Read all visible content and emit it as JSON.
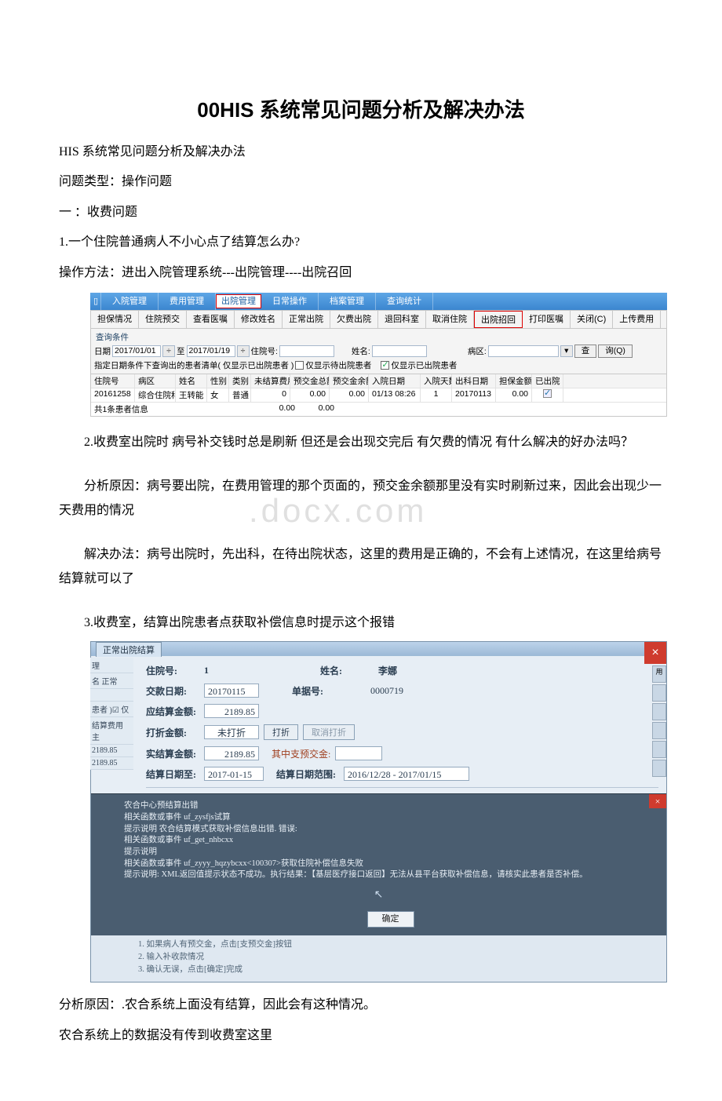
{
  "doc": {
    "title": "00HIS 系统常见问题分析及解决办法",
    "h1": "HIS 系统常见问题分析及解决办法",
    "p_type": "问题类型：操作问题",
    "p_sec1": "一 ：收费问题",
    "q1": "1.一个住院普通病人不小心点了结算怎么办?",
    "a1": "操作方法：进出入院管理系统---出院管理----出院召回",
    "q2": "2.收费室出院时 病号补交钱时总是刷新 但还是会出现交完后 有欠费的情况 有什么解决的好办法吗？",
    "a2a": "分析原因：病号要出院，在费用管理的那个页面的，预交金余额那里没有实时刷新过来，因此会出现少一天费用的情况",
    "a2b": "解决办法：病号出院时，先出科，在待出院状态，这里的费用是正确的，不会有上述情况，在这里给病号结算就可以了",
    "q3": "3.收费室，结算出院患者点获取补偿信息时提示这个报错",
    "a3a": "分析原因：.农合系统上面没有结算，因此会有这种情况。",
    "a3b": " 农合系统上的数据没有传到收费室这里",
    "watermark": ".docx.com"
  },
  "ss1": {
    "tabs": [
      "入院管理",
      "费用管理",
      "出院管理",
      "日常操作",
      "档案管理",
      "查询统计"
    ],
    "toolbar": [
      "担保情况",
      "住院预交",
      "查看医嘱",
      "修改姓名",
      "正常出院",
      "欠费出院",
      "退回科室",
      "取消住院",
      "出院招回",
      "打印医嘱",
      "关闭(C)",
      "上传费用"
    ],
    "filter_title": "查询条件",
    "filter": {
      "lbl_date": "日期",
      "date_from": "2017/01/01",
      "date_to": "2017/01/19",
      "lbl_to": "至",
      "spin": "÷",
      "lbl_zyh": "住院号:",
      "lbl_xm": "姓名:",
      "lbl_bq": "病区:",
      "btn_cha": "查",
      "btn_xun": "询(Q)",
      "note": "指定日期条件下查询出的患者清单( 仅显示已出院患者 )",
      "chk1": "仅显示待出院患者",
      "chk2": "仅显示已出院患者"
    },
    "grid": {
      "head": [
        "住院号",
        "病区",
        "姓名",
        "性别",
        "类别",
        "未结算费用",
        "预交金总额",
        "预交金余额",
        "入院日期",
        "入院天数",
        "出科日期",
        "担保金额",
        "已出院"
      ],
      "row": [
        "20161258",
        "综合住院科",
        "王转能",
        "女",
        "普通",
        "0",
        "0.00",
        "0.00",
        "01/13 08:26",
        "1",
        "20170113",
        "0.00",
        "☑"
      ],
      "foot_label": "共1条患者信息",
      "foot_v1": "0.00",
      "foot_v2": "0.00"
    }
  },
  "ss2": {
    "tab": "正常出院结算",
    "zyh_lbl": "住院号:",
    "zyh": "1",
    "xm_lbl": "姓名:",
    "xm": "李娜",
    "left": [
      "理",
      "名    正常",
      "患者  )☑ 仅",
      "结算费用 主",
      "2189.85",
      "2189.85"
    ],
    "right_btn": "用",
    "jkrq_lbl": "交款日期:",
    "jkrq": "20170115",
    "djh_lbl": "单据号:",
    "djh": "0000719",
    "yjs_lbl": "应结算金额:",
    "yjs": "2189.85",
    "dzje_lbl": "打折金额:",
    "wdz": "未打折",
    "dz_btn": "打折",
    "qxdz": "取消打折",
    "sjs_lbl": "实结算金额:",
    "sjs": "2189.85",
    "qzzf_lbl": "其中支预交金:",
    "jsrq_lbl": "结算日期至:",
    "jsrq": "2017-01-15",
    "jsfw_lbl": "结算日期范围:",
    "jsfw": "2016/12/28 - 2017/01/15",
    "err_lines": [
      "农合中心预结算出错",
      "相关函数或事件  uf_zysfjs试算",
      "提示说明 农合结算模式获取补偿信息出错. 错误:",
      "相关函数或事件  uf_get_nhbcxx",
      "提示说明",
      "相关函数或事件  uf_zyyy_hqzybcxx<100307>获取住院补偿信息失败",
      "提示说明: XML返回值提示状态不成功。执行结果：【基层医疗接口返回】无法从县平台获取补偿信息，请核实此患者是否补偿。"
    ],
    "ok": "确定",
    "foot": [
      "1. 如果病人有预交金，点击[支预交金]按钮",
      "2. 输入补收款情况",
      "3. 确认无误，点击[确定]完成"
    ]
  }
}
